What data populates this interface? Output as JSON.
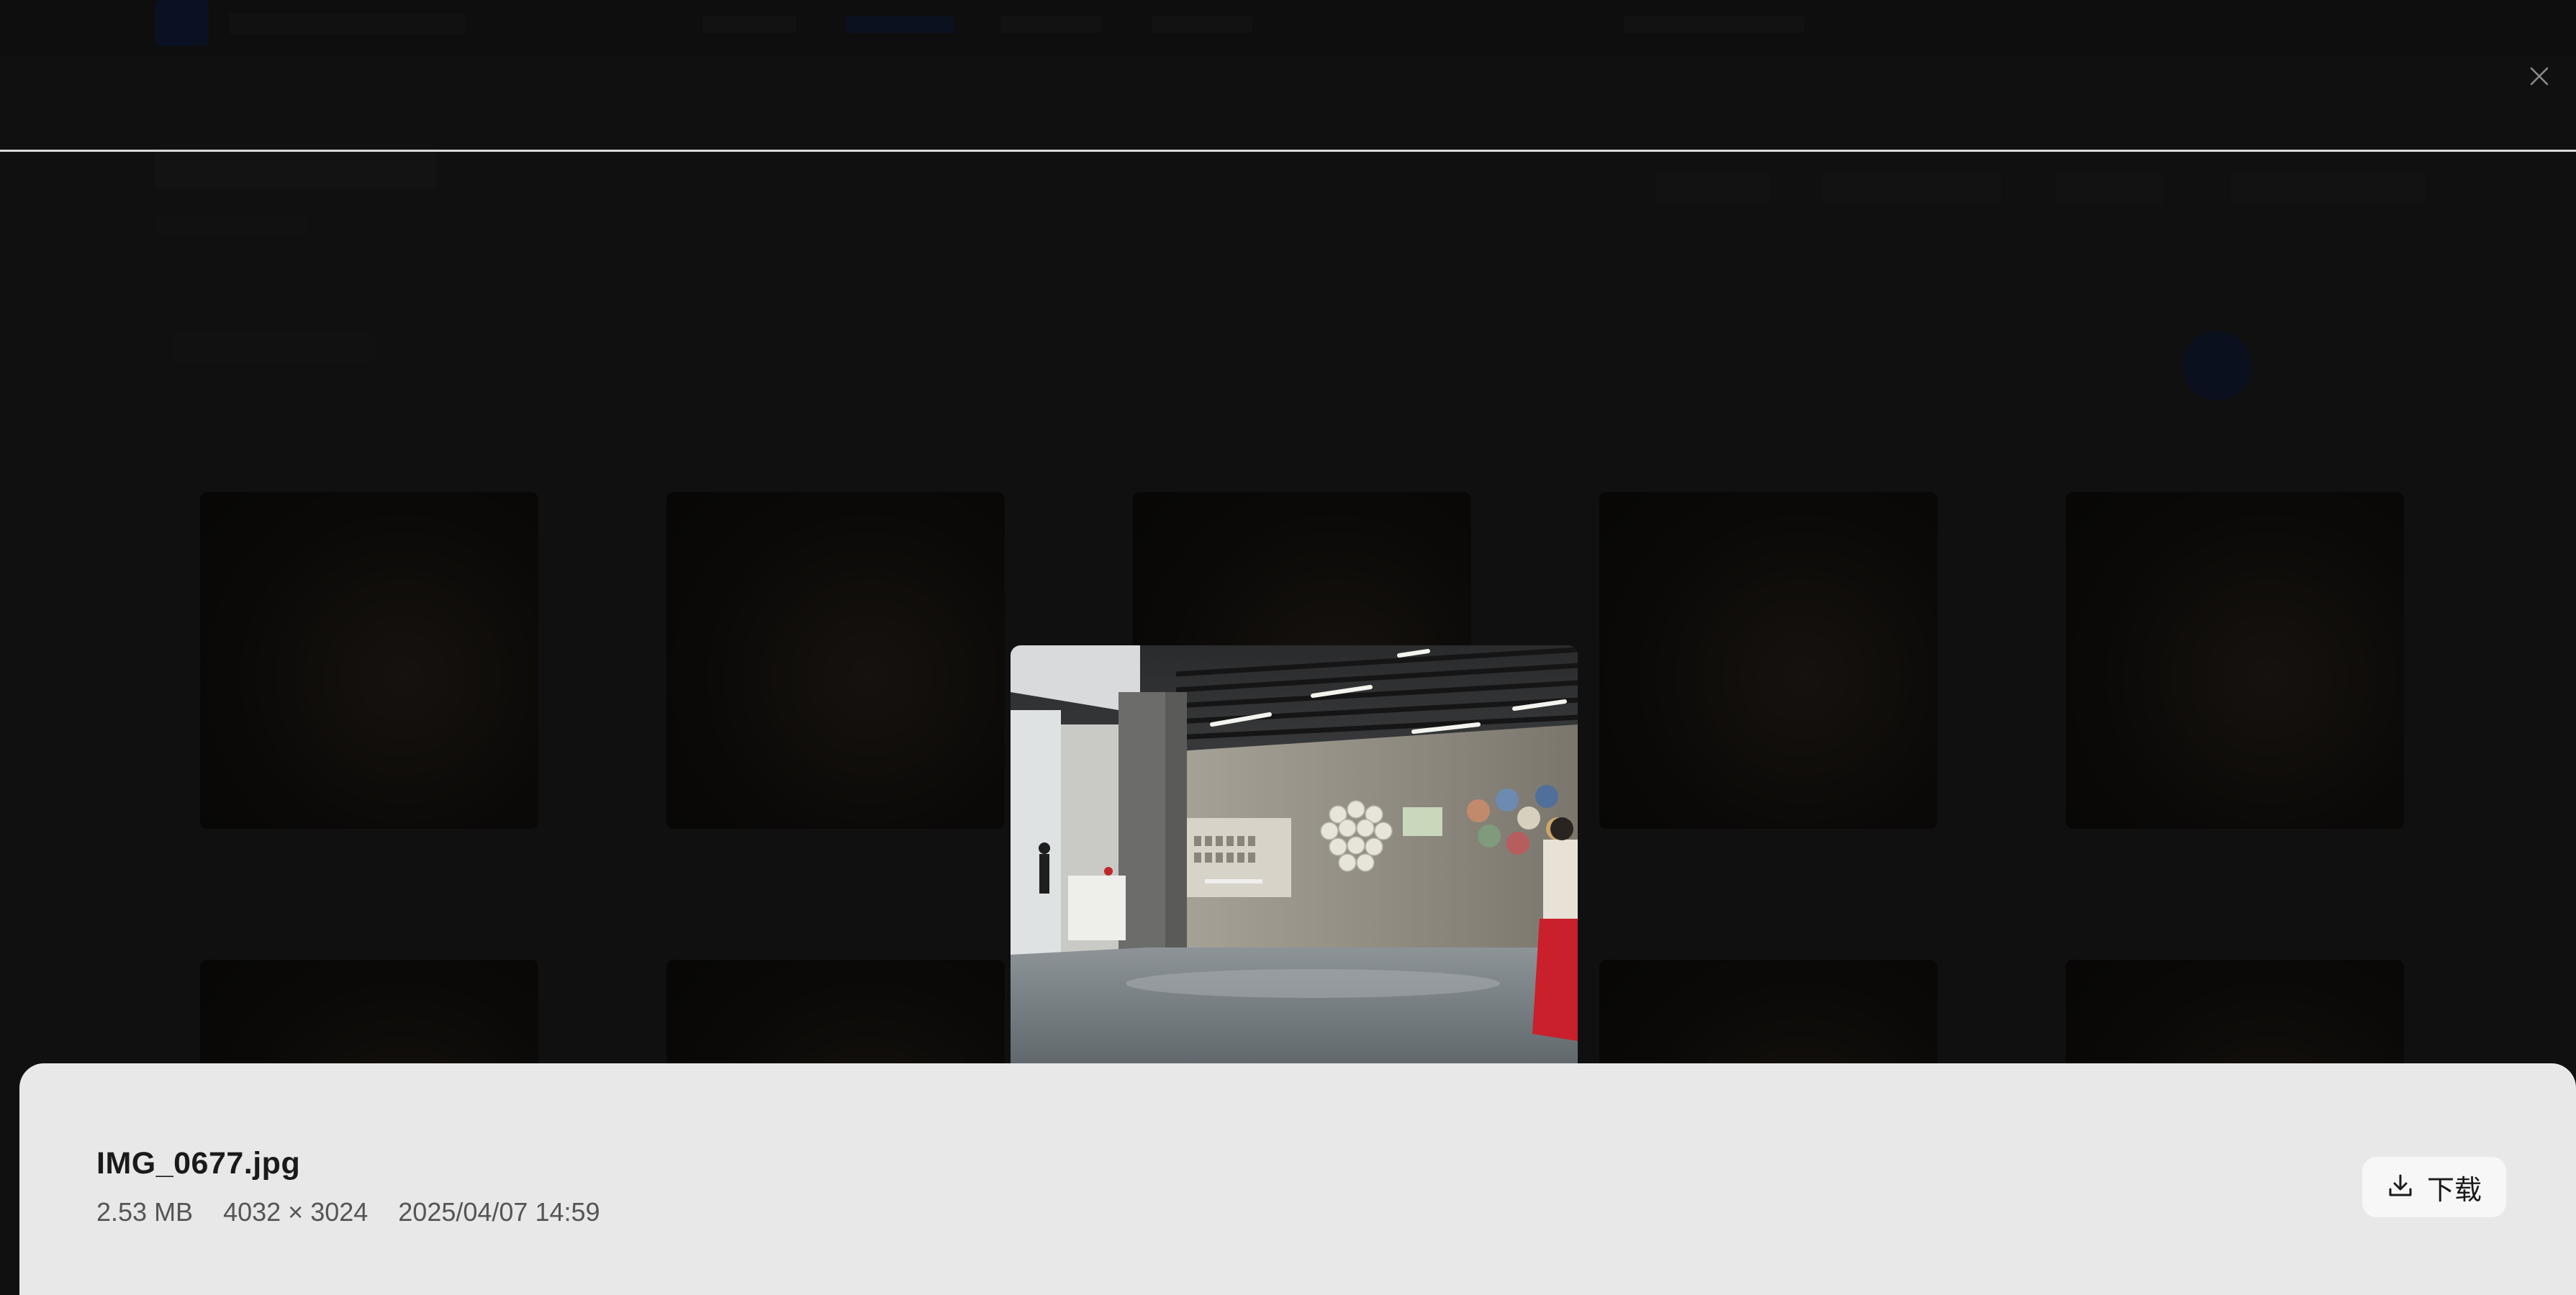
{
  "overlay": {
    "close_icon": "close-icon"
  },
  "preview": {
    "description_icon": "photo-preview"
  },
  "file": {
    "name": "IMG_0677.jpg",
    "size": "2.53 MB",
    "dimensions": "4032 × 3024",
    "date": "2025/04/07 14:59"
  },
  "actions": {
    "download_label": "下载",
    "download_icon": "download-icon"
  },
  "colors": {
    "panel_bg": "#e8e8e8",
    "overlay_bg": "#181818",
    "accent_dim": "#1d2d50"
  }
}
